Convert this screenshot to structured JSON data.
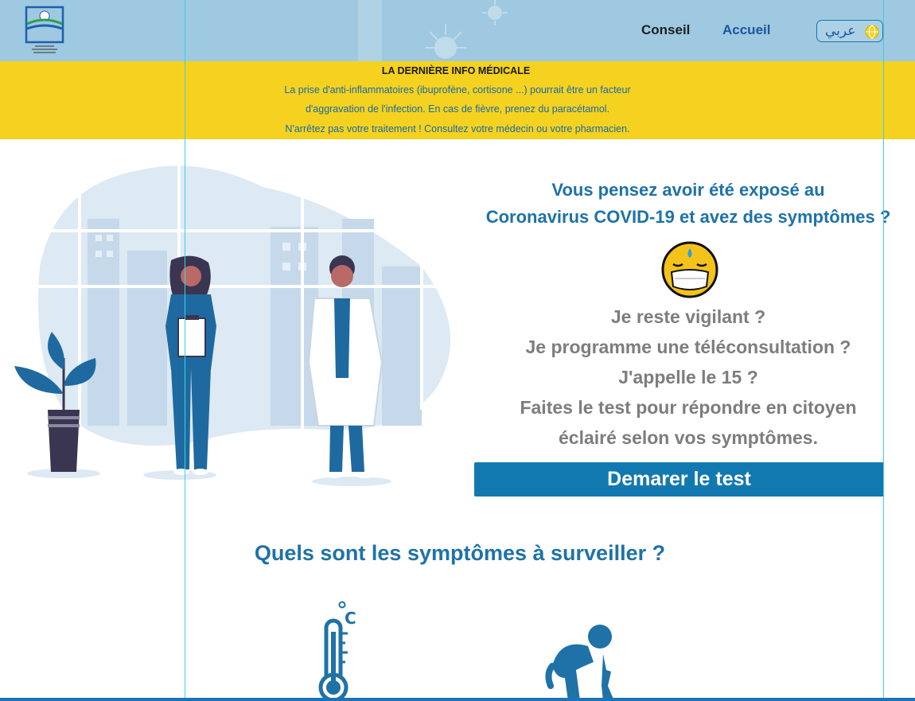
{
  "header": {
    "logo_name": "ministry-logo",
    "nav": [
      {
        "label": "Conseil"
      },
      {
        "label": "Accueil"
      }
    ],
    "language_button": "عربي",
    "colors": {
      "header_bg": "#9ec9e0",
      "accent": "#1a56a0"
    }
  },
  "banner": {
    "title": "LA DERNIÈRE INFO MÉDICALE",
    "lines": [
      "La prise d'anti-inflammatoires (ibuprofène, cortisone ...) pourrait être un facteur",
      "d'aggravation de l'infection. En cas de fièvre, prenez du paracétamol.",
      "N'arrêtez pas votre traitement ! Consultez votre médecin ou votre pharmacien."
    ],
    "color": "#f4d21f"
  },
  "hero": {
    "title_line1": "Vous pensez avoir été exposé au",
    "title_line2": "Coronavirus COVID-19 et avez des symptômes ?",
    "questions": [
      "Je reste vigilant ?",
      "Je programme une téléconsultation ?",
      "J'appelle le 15 ?",
      "Faites le test pour répondre en citoyen",
      "éclairé selon vos symptômes."
    ],
    "button": "Demarer le test",
    "button_color": "#1278b0"
  },
  "symptoms": {
    "title": "Quels sont les symptômes à surveiller ?",
    "icons": [
      "thermometer-icon",
      "coughing-person-icon"
    ]
  }
}
